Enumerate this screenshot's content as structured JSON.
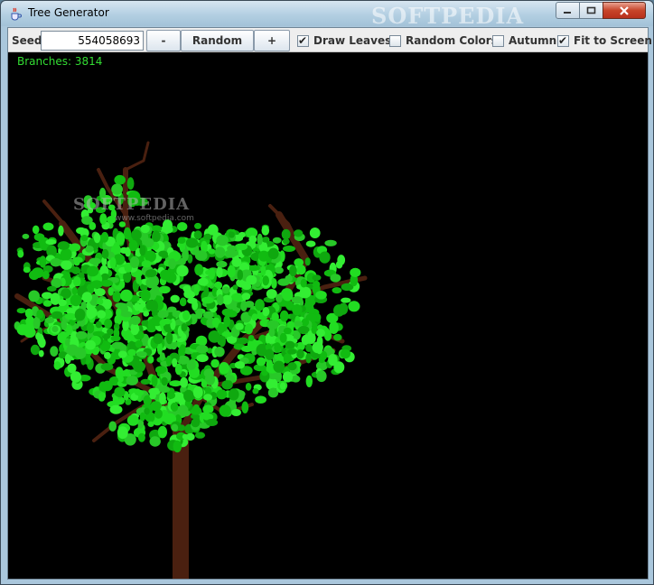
{
  "window": {
    "title": "Tree Generator",
    "watermark": "SOFTPEDIA"
  },
  "toolbar": {
    "seed_label": "Seed:",
    "seed_value": "554058693",
    "minus_label": "-",
    "random_label": "Random",
    "plus_label": "+",
    "checkboxes": [
      {
        "label": "Draw Leaves",
        "checked": true
      },
      {
        "label": "Random Colors",
        "checked": false
      },
      {
        "label": "Autumn",
        "checked": false
      },
      {
        "label": "Fit to Screen",
        "checked": true
      }
    ]
  },
  "canvas": {
    "branches_text": "Branches: 3814",
    "watermark": "SOFTPEDIA",
    "watermark_sub": "www.softpedia.com",
    "background": "#000000",
    "trunk_color": "#4a2010",
    "leaf_color": "#22dd22"
  },
  "icons": {
    "app": "java-cup-icon",
    "minimize": "minimize-icon",
    "maximize": "maximize-icon",
    "close": "close-icon"
  }
}
